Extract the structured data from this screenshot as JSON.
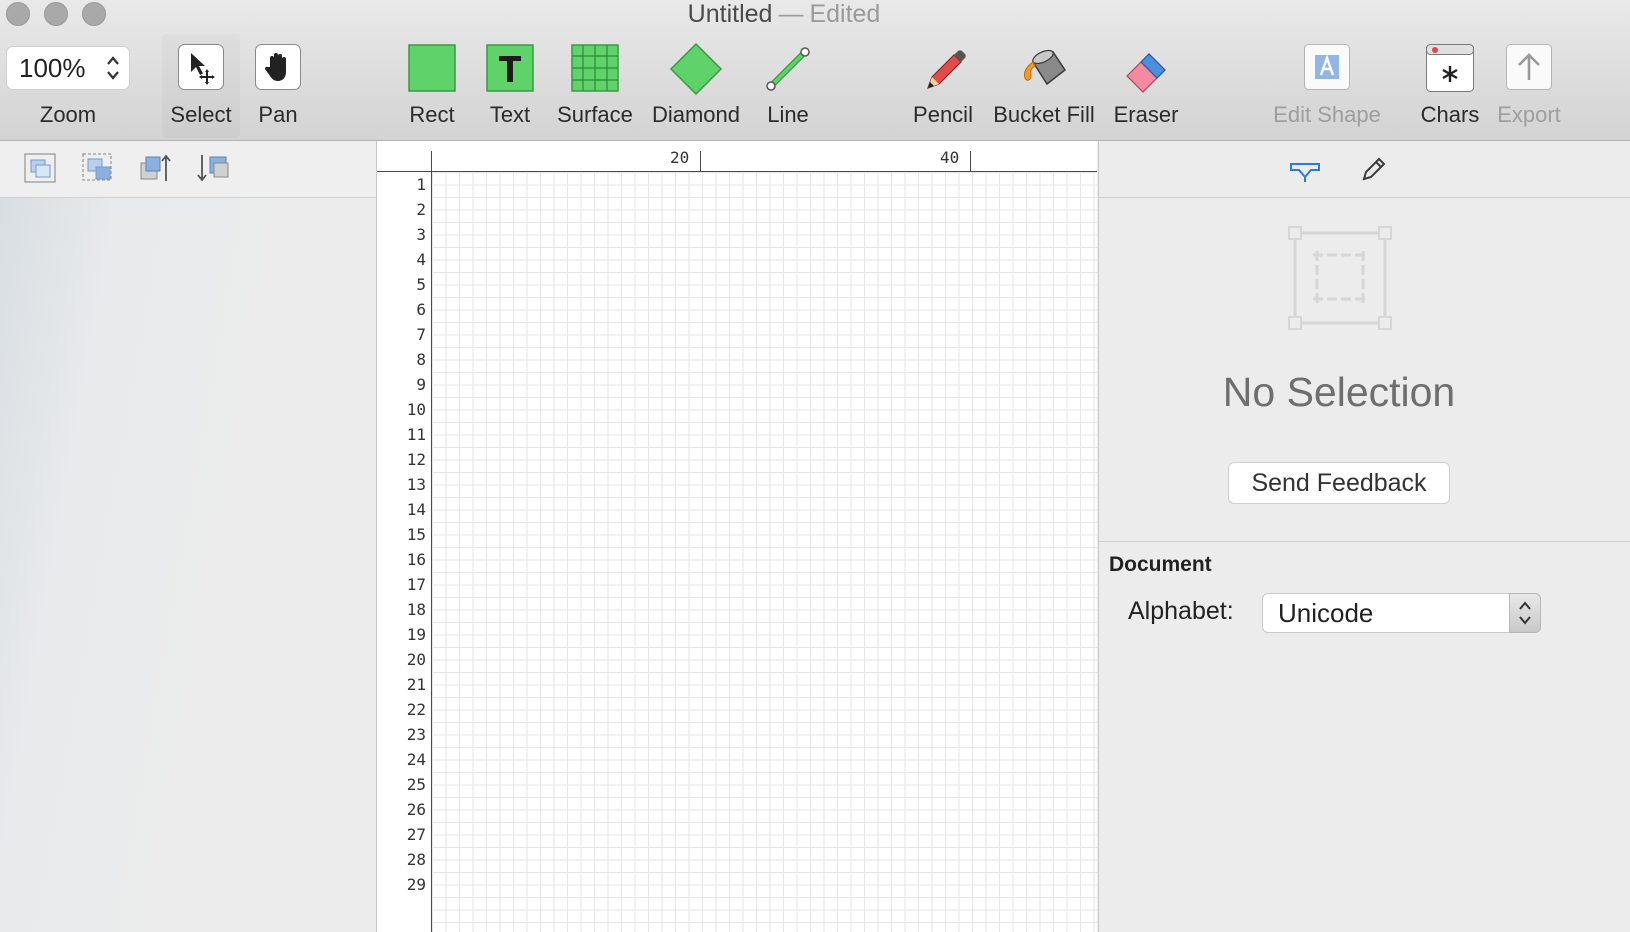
{
  "window": {
    "title": "Untitled",
    "separator": "—",
    "status": "Edited"
  },
  "toolbar": {
    "zoom": {
      "value": "100%",
      "label": "Zoom"
    },
    "tools": [
      {
        "id": "select",
        "label": "Select",
        "icon": "select-arrow-icon",
        "active": true
      },
      {
        "id": "pan",
        "label": "Pan",
        "icon": "hand-icon"
      },
      {
        "id": "rect",
        "label": "Rect",
        "icon": "rect-icon"
      },
      {
        "id": "text",
        "label": "Text",
        "icon": "text-icon"
      },
      {
        "id": "surface",
        "label": "Surface",
        "icon": "surface-grid-icon"
      },
      {
        "id": "diamond",
        "label": "Diamond",
        "icon": "diamond-icon"
      },
      {
        "id": "line",
        "label": "Line",
        "icon": "line-icon"
      },
      {
        "id": "pencil",
        "label": "Pencil",
        "icon": "pencil-icon"
      },
      {
        "id": "bucket",
        "label": "Bucket Fill",
        "icon": "bucket-fill-icon"
      },
      {
        "id": "eraser",
        "label": "Eraser",
        "icon": "eraser-icon"
      },
      {
        "id": "edit-shape",
        "label": "Edit Shape",
        "icon": "edit-shape-icon",
        "disabled": true
      },
      {
        "id": "chars",
        "label": "Chars",
        "icon": "chars-icon"
      },
      {
        "id": "export",
        "label": "Export",
        "icon": "export-icon",
        "disabled": true
      }
    ],
    "accent_green": "#5fd36a"
  },
  "canvas": {
    "ruler_top": [
      "20",
      "40"
    ],
    "ruler_left": [
      "1",
      "2",
      "3",
      "4",
      "5",
      "6",
      "7",
      "8",
      "9",
      "10",
      "11",
      "12",
      "13",
      "14",
      "15",
      "16",
      "17",
      "18",
      "19",
      "20",
      "21",
      "22",
      "23",
      "24",
      "25",
      "26",
      "27",
      "28",
      "29"
    ]
  },
  "inspector": {
    "no_selection": "No Selection",
    "feedback_label": "Send Feedback",
    "document_heading": "Document",
    "alphabet_label": "Alphabet:",
    "alphabet_value": "Unicode"
  }
}
